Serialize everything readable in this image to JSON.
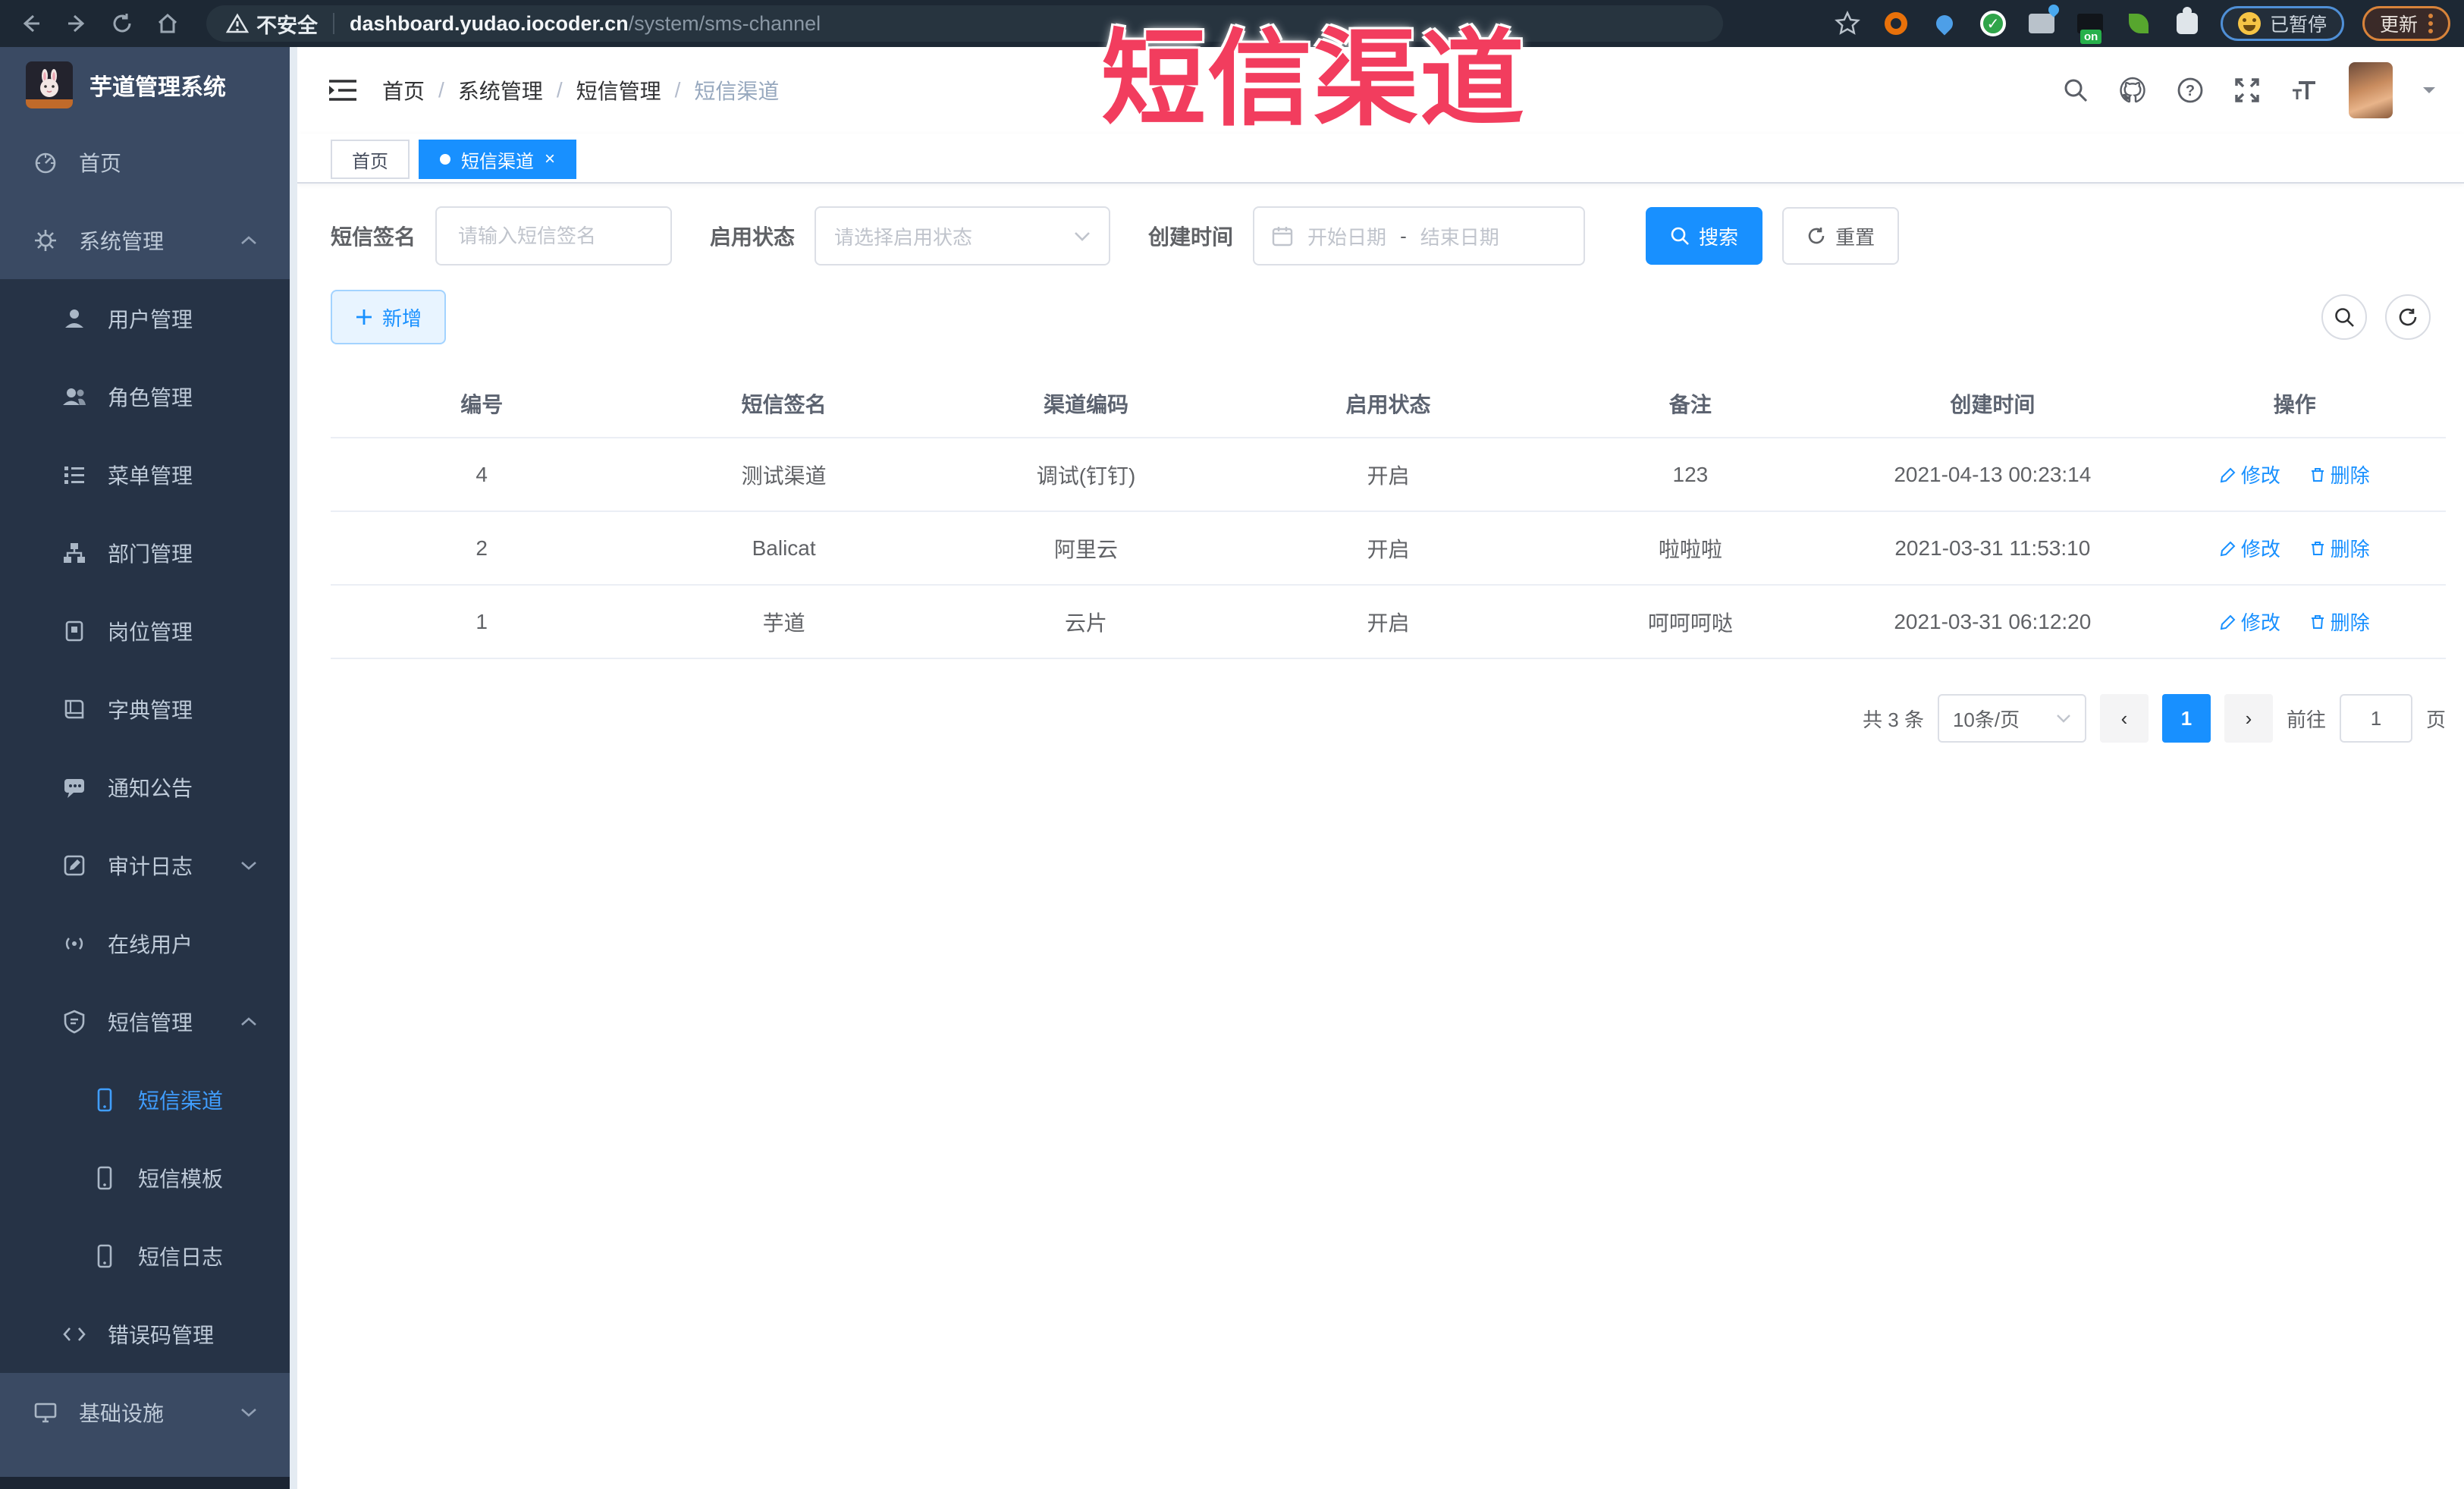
{
  "colors": {
    "accent": "#1890ff",
    "sidebar_bg": "#3a4a63",
    "submenu_bg": "#263346",
    "active_menu_text": "#409eff",
    "overlay_red": "#f23d5e"
  },
  "browser": {
    "security_label": "不安全",
    "url_domain": "dashboard.yudao.iocoder.cn",
    "url_path": "/system/sms-channel",
    "ext_on_label": "on",
    "paused_label": "已暂停",
    "update_label": "更新"
  },
  "overlay": {
    "text": "短信渠道"
  },
  "sidebar": {
    "title": "芋道管理系统",
    "items": [
      {
        "label": "首页"
      },
      {
        "label": "系统管理"
      },
      {
        "label": "用户管理"
      },
      {
        "label": "角色管理"
      },
      {
        "label": "菜单管理"
      },
      {
        "label": "部门管理"
      },
      {
        "label": "岗位管理"
      },
      {
        "label": "字典管理"
      },
      {
        "label": "通知公告"
      },
      {
        "label": "审计日志"
      },
      {
        "label": "在线用户"
      },
      {
        "label": "短信管理"
      },
      {
        "label": "短信渠道"
      },
      {
        "label": "短信模板"
      },
      {
        "label": "短信日志"
      },
      {
        "label": "错误码管理"
      },
      {
        "label": "基础设施"
      }
    ]
  },
  "header": {
    "breadcrumb": [
      "首页",
      "系统管理",
      "短信管理",
      "短信渠道"
    ],
    "breadcrumb_separator": "/"
  },
  "tabs": {
    "home_label": "首页",
    "active_label": "短信渠道",
    "close_glyph": "×"
  },
  "filters": {
    "sign_label": "短信签名",
    "sign_placeholder": "请输入短信签名",
    "status_label": "启用状态",
    "status_placeholder": "请选择启用状态",
    "time_label": "创建时间",
    "start_placeholder": "开始日期",
    "range_separator": "-",
    "end_placeholder": "结束日期",
    "search_label": "搜索",
    "reset_label": "重置"
  },
  "toolbar": {
    "add_label": "新增"
  },
  "table": {
    "columns": [
      "编号",
      "短信签名",
      "渠道编码",
      "启用状态",
      "备注",
      "创建时间",
      "操作"
    ],
    "edit_label": "修改",
    "delete_label": "删除",
    "rows": [
      {
        "id": "4",
        "sign": "测试渠道",
        "code": "调试(钉钉)",
        "status": "开启",
        "remark": "123",
        "time": "2021-04-13 00:23:14"
      },
      {
        "id": "2",
        "sign": "Balicat",
        "code": "阿里云",
        "status": "开启",
        "remark": "啦啦啦",
        "time": "2021-03-31 11:53:10"
      },
      {
        "id": "1",
        "sign": "芋道",
        "code": "云片",
        "status": "开启",
        "remark": "呵呵呵哒",
        "time": "2021-03-31 06:12:20"
      }
    ]
  },
  "pagination": {
    "total_label": "共 3 条",
    "page_size_label": "10条/页",
    "prev_glyph": "‹",
    "next_glyph": "›",
    "current_page": "1",
    "jump_prefix": "前往",
    "jump_value": "1",
    "jump_suffix": "页"
  },
  "icons": [
    "back-icon",
    "forward-icon",
    "reload-icon",
    "home-icon",
    "warning-icon",
    "star-icon",
    "puzzle-icon",
    "search-icon",
    "github-icon",
    "help-icon",
    "fullscreen-icon",
    "font-size-icon",
    "calendar-icon",
    "refresh-icon",
    "plus-icon",
    "edit-icon",
    "delete-icon",
    "chevron-up-icon",
    "chevron-down-icon"
  ]
}
